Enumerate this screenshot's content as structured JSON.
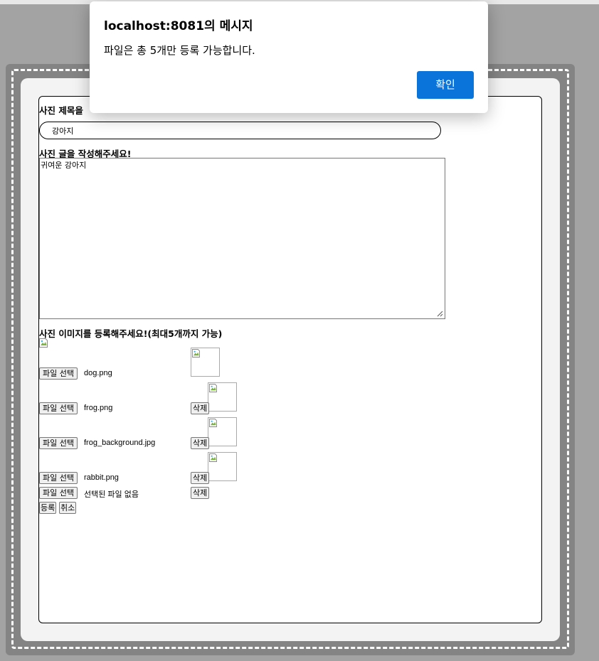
{
  "dialog": {
    "title": "localhost:8081의 메시지",
    "message": "파일은 총 5개만 등록 가능합니다.",
    "ok_label": "확인"
  },
  "form": {
    "title_label": "사진 제목을",
    "title_value": "강아지",
    "content_label": "사진 글을 작성해주세요!",
    "content_value": "귀여운 강아지",
    "image_label": "사진 이미지를 등록해주세요!(최대5개까지 가능)",
    "file_button_label": "파일 선택",
    "delete_label": "삭제",
    "files": [
      "dog.png",
      "frog.png",
      "frog_background.jpg",
      "rabbit.png",
      "선택된 파일 없음"
    ],
    "submit_label": "등록",
    "cancel_label": "취소"
  },
  "icons": [
    "broken-image-icon",
    "resize-grip-icon"
  ]
}
